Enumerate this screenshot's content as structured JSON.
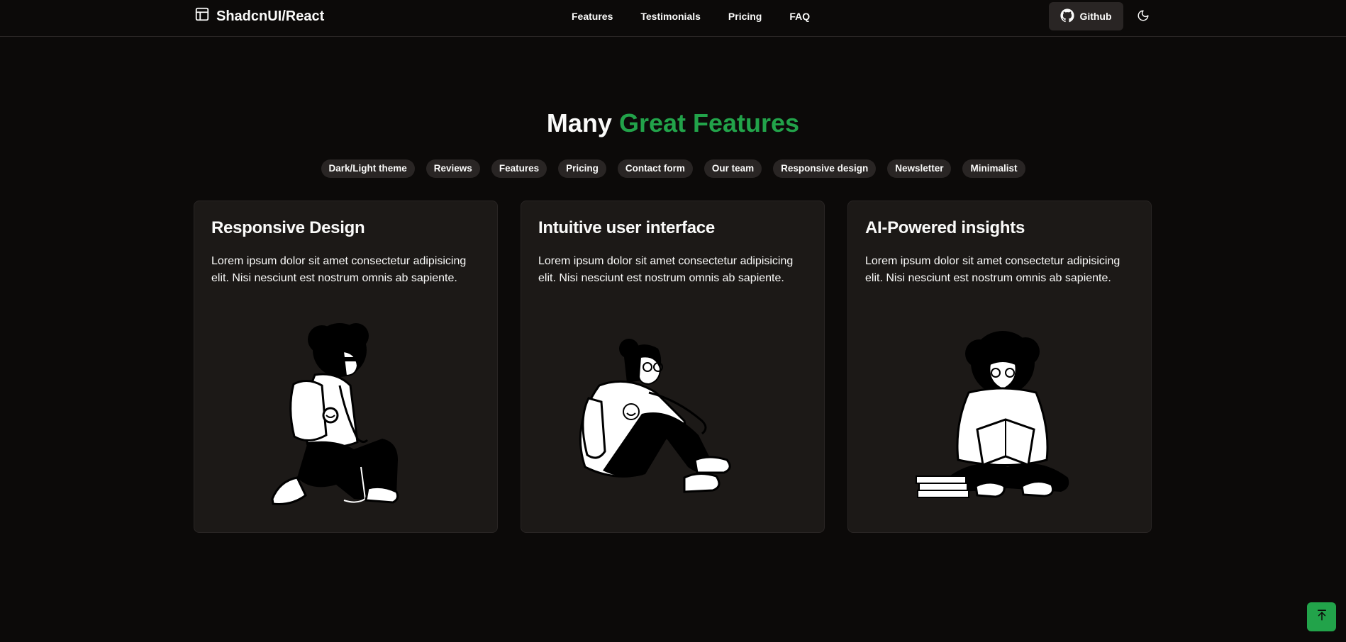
{
  "colors": {
    "background": "#0c0a09",
    "accent": "#22a34a",
    "card": "#1c1917",
    "badge": "#292524"
  },
  "navbar": {
    "brand_name": "ShadcnUI/React",
    "brand_icon": "layout-icon",
    "links": [
      {
        "label": "Features"
      },
      {
        "label": "Testimonials"
      },
      {
        "label": "Pricing"
      },
      {
        "label": "FAQ"
      }
    ],
    "github_label": "Github",
    "github_icon": "github-icon",
    "theme_icon": "moon-icon"
  },
  "features": {
    "title_prefix": "Many",
    "title_accent": "Great Features",
    "badges": [
      "Dark/Light theme",
      "Reviews",
      "Features",
      "Pricing",
      "Contact form",
      "Our team",
      "Responsive design",
      "Newsletter",
      "Minimalist"
    ],
    "cards": [
      {
        "title": "Responsive Design",
        "description": "Lorem ipsum dolor sit amet consectetur adipisicing elit. Nisi nesciunt est nostrum omnis ab sapiente.",
        "illustration": "person-kneeling-illustration"
      },
      {
        "title": "Intuitive user interface",
        "description": "Lorem ipsum dolor sit amet consectetur adipisicing elit. Nisi nesciunt est nostrum omnis ab sapiente.",
        "illustration": "person-sitting-illustration"
      },
      {
        "title": "AI-Powered insights",
        "description": "Lorem ipsum dolor sit amet consectetur adipisicing elit. Nisi nesciunt est nostrum omnis ab sapiente.",
        "illustration": "person-reading-illustration"
      }
    ]
  },
  "scroll_top_icon": "arrow-up-to-line-icon"
}
